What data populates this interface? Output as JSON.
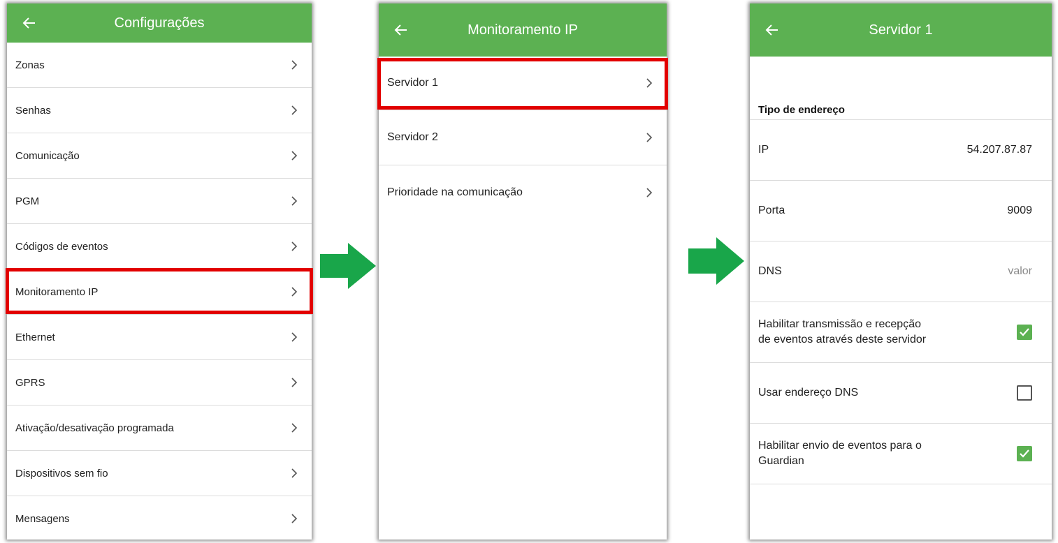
{
  "colors": {
    "appbar": "#5cb152",
    "highlight": "#e20000",
    "arrow": "#19a64a"
  },
  "screen1": {
    "title": "Configurações",
    "back_icon": "arrow-left-icon",
    "items": [
      {
        "label": "Zonas"
      },
      {
        "label": "Senhas"
      },
      {
        "label": "Comunicação"
      },
      {
        "label": "PGM"
      },
      {
        "label": "Códigos de eventos"
      },
      {
        "label": "Monitoramento IP"
      },
      {
        "label": "Ethernet"
      },
      {
        "label": "GPRS"
      },
      {
        "label": "Ativação/desativação programada"
      },
      {
        "label": "Dispositivos sem fio"
      },
      {
        "label": "Mensagens"
      }
    ]
  },
  "screen2": {
    "title": "Monitoramento IP",
    "back_icon": "arrow-left-icon",
    "items": [
      {
        "label": "Servidor 1"
      },
      {
        "label": "Servidor 2"
      },
      {
        "label": "Prioridade na comunicação"
      }
    ]
  },
  "screen3": {
    "title": "Servidor 1",
    "back_icon": "arrow-left-icon",
    "section_title": "Tipo de endereço",
    "ip": {
      "label": "IP",
      "value": "54.207.87.87"
    },
    "porta": {
      "label": "Porta",
      "value": "9009"
    },
    "dns": {
      "label": "DNS",
      "placeholder": "valor"
    },
    "checks": [
      {
        "label_line1": "Habilitar transmissão e recepção",
        "label_line2": "de eventos através deste servidor",
        "checked": true
      },
      {
        "label_line1": "Usar endereço DNS",
        "label_line2": "",
        "checked": false
      },
      {
        "label_line1": "Habilitar envio de eventos para o",
        "label_line2": "Guardian",
        "checked": true
      }
    ]
  }
}
